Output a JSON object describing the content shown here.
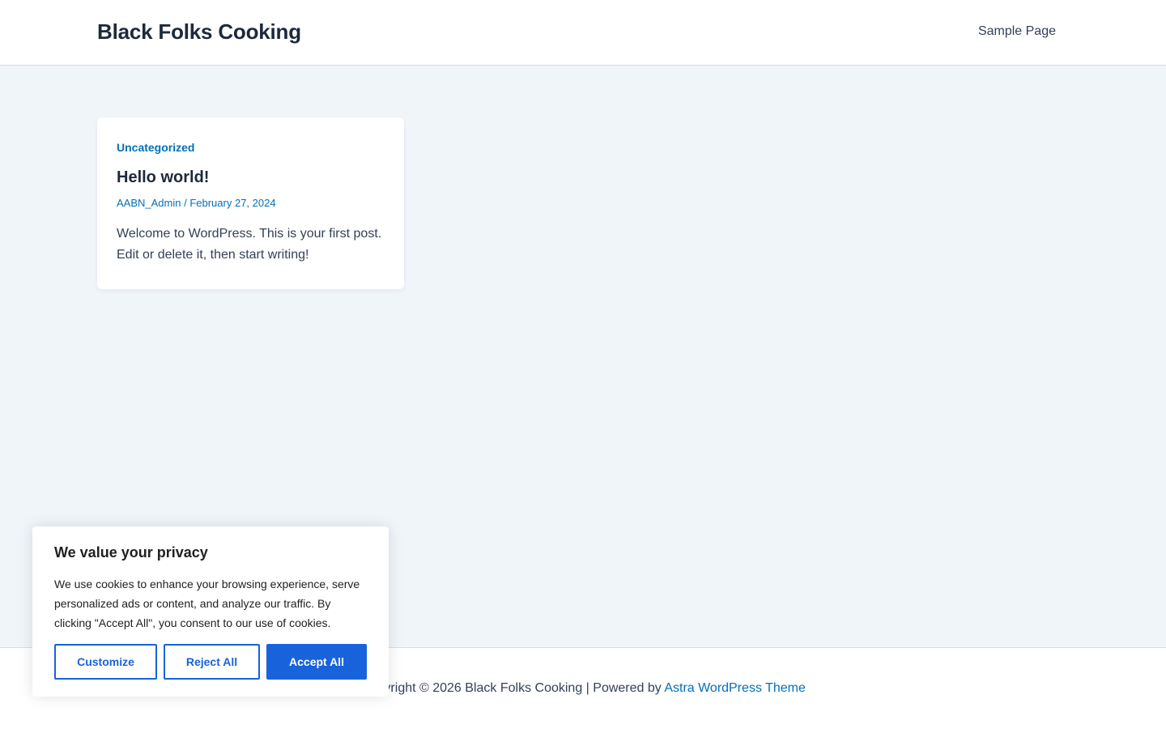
{
  "header": {
    "site_title": "Black Folks Cooking",
    "nav_items": [
      "Sample Page"
    ]
  },
  "post": {
    "category": "Uncategorized",
    "title": "Hello world!",
    "author": "AABN_Admin",
    "meta_separator": " / ",
    "date": "February 27, 2024",
    "excerpt": "Welcome to WordPress. This is your first post. Edit or delete it, then start writing!"
  },
  "footer": {
    "copyright": "Copyright © 2026 Black Folks Cooking | Powered by ",
    "theme_link": "Astra WordPress Theme"
  },
  "cookie_banner": {
    "title": "We value your privacy",
    "description": "We use cookies to enhance your browsing experience, serve personalized ads or content, and analyze our traffic. By clicking \"Accept All\", you consent to our use of cookies.",
    "customize_label": "Customize",
    "reject_label": "Reject All",
    "accept_label": "Accept All"
  },
  "colors": {
    "link": "#0170b9",
    "heading": "#1e293b",
    "body_text": "#334155",
    "page_background": "#f0f5fa",
    "cookie_accent": "#1863dc"
  }
}
